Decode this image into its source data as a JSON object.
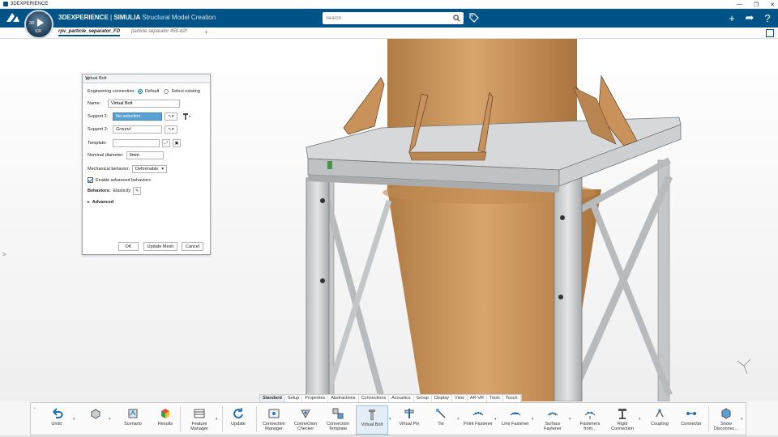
{
  "window": {
    "title": "3DEXPERIENCE",
    "controls": [
      "—",
      "❐",
      "✕"
    ]
  },
  "topbar": {
    "brand": "3DEXPERIENCE",
    "separator": " | ",
    "company": "SIMULIA",
    "app": "Structural Model Creation",
    "compass_label": "V,R",
    "compass_num": "3D",
    "search_placeholder": "Search",
    "tools": [
      "+",
      "➦",
      "?"
    ]
  },
  "tabs": {
    "items": [
      "rpv_particle_separator_FD",
      "particle separator 450-b2f"
    ],
    "add": "+"
  },
  "dialog": {
    "title": "Virtual Bolt",
    "close": "×",
    "engineering_connection_label": "Engineering connection:",
    "option_default": "Default",
    "option_select_existing": "Select existing",
    "name_label": "Name:",
    "name_value": "Virtual Bolt",
    "support1_label": "Support 1:",
    "support1_value": "No selection",
    "support2_label": "Support 2:",
    "support2_value": "Ground",
    "template_label": "Template:",
    "template_value": "",
    "nominal_diameter_label": "Nominal diameter:",
    "nominal_diameter_value": "0mm",
    "mechanical_behavior_label": "Mechanical behavior:",
    "mechanical_behavior_value": "Deformable",
    "enable_advanced_label": "Enable advanced behaviors",
    "behaviors_label": "Behaviors:",
    "behaviors_value": "Elasticity",
    "advanced_label": "Advanced",
    "ok": "OK",
    "update_mesh": "Update Mesh",
    "cancel": "Cancel"
  },
  "ribbon_tabs": [
    {
      "label": "Standard",
      "active": true
    },
    {
      "label": "Setup"
    },
    {
      "label": "Properties"
    },
    {
      "label": "Abstractions"
    },
    {
      "label": "Connections"
    },
    {
      "label": "Acoustics"
    },
    {
      "label": "Group"
    },
    {
      "label": "Display"
    },
    {
      "label": "View"
    },
    {
      "label": "AR-VR"
    },
    {
      "label": "Tools"
    },
    {
      "label": "Touch"
    }
  ],
  "ribbon_tools": [
    {
      "label": "Undo"
    },
    {
      "label": ""
    },
    {
      "label": "Scenario"
    },
    {
      "label": "Results"
    },
    {
      "label": "Feature Manager"
    },
    {
      "label": "Update"
    },
    {
      "label": "Connection Manager"
    },
    {
      "label": "Connection Checker"
    },
    {
      "label": "Connection Template"
    },
    {
      "label": "Virtual Bolt",
      "active": true
    },
    {
      "label": "Virtual Pin"
    },
    {
      "label": "Tie"
    },
    {
      "label": "Point Fastener"
    },
    {
      "label": "Line Fastener"
    },
    {
      "label": "Surface Fastener"
    },
    {
      "label": "Fasteners from..."
    },
    {
      "label": "Rigid Connection"
    },
    {
      "label": "Coupling"
    },
    {
      "label": "Connector"
    },
    {
      "label": "Show Disconnec..."
    }
  ],
  "colors": {
    "topbar": "#005386",
    "cylinder": "#c8955c",
    "steel": "#c9ccce",
    "selection": "#5aa1d3"
  }
}
